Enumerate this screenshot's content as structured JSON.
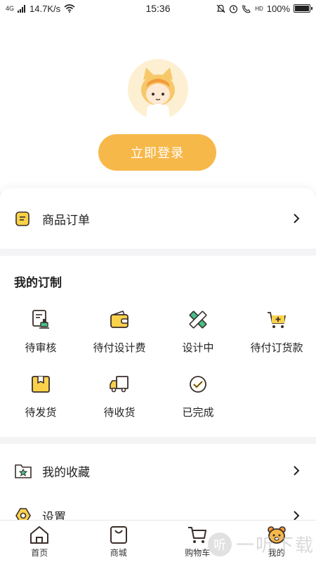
{
  "status_bar": {
    "network": "4G",
    "speed": "14.7K/s",
    "time": "15:36",
    "battery": "100%",
    "hd_label": "HD"
  },
  "profile": {
    "login_label": "立即登录"
  },
  "orders": {
    "label": "商品订单"
  },
  "custom": {
    "title": "我的订制",
    "items": [
      {
        "label": "待审核",
        "icon": "review-icon"
      },
      {
        "label": "待付设计费",
        "icon": "wallet-icon"
      },
      {
        "label": "设计中",
        "icon": "design-icon"
      },
      {
        "label": "待付订货款",
        "icon": "cart-plus-icon"
      },
      {
        "label": "待发货",
        "icon": "box-icon"
      },
      {
        "label": "待收货",
        "icon": "truck-icon"
      },
      {
        "label": "已完成",
        "icon": "check-circle-icon"
      }
    ]
  },
  "list": {
    "favorites_label": "我的收藏",
    "settings_label": "设置"
  },
  "tabs": [
    {
      "label": "首页",
      "icon": "home-icon"
    },
    {
      "label": "商城",
      "icon": "shop-bag-icon"
    },
    {
      "label": "购物车",
      "icon": "cart-icon"
    },
    {
      "label": "我的",
      "icon": "bear-icon"
    }
  ],
  "watermark": {
    "text": "一听下载",
    "circle": "听"
  },
  "colors": {
    "accent": "#f7b84a",
    "icon_yellow": "#f9d24a",
    "icon_green": "#43c18a",
    "icon_dark": "#3a2e2a"
  }
}
